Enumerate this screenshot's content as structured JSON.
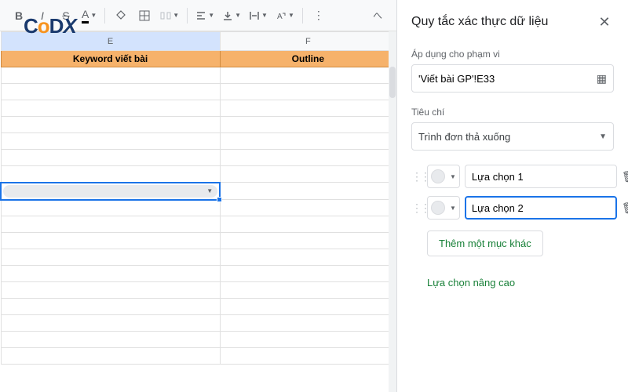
{
  "toolbar": {
    "bold": "B",
    "italic": "I",
    "strike": "S",
    "text_color": "A"
  },
  "sheet": {
    "col_e_letter": "E",
    "col_f_letter": "F",
    "header_e": "Keyword viết bài",
    "header_f": "Outline"
  },
  "sidebar": {
    "title": "Quy tắc xác thực dữ liệu",
    "range_label": "Áp dụng cho phạm vi",
    "range_value": "'Viết bài GP'!E33",
    "criteria_label": "Tiêu chí",
    "criteria_value": "Trình đơn thả xuống",
    "option1_value": "Lựa chọn 1",
    "option2_value": "Lựa chọn 2",
    "add_item": "Thêm một mục khác",
    "advanced": "Lựa chọn nâng cao"
  },
  "logo": {
    "p1": "C",
    "p2": "o",
    "p3": "D",
    "p4": "X"
  }
}
